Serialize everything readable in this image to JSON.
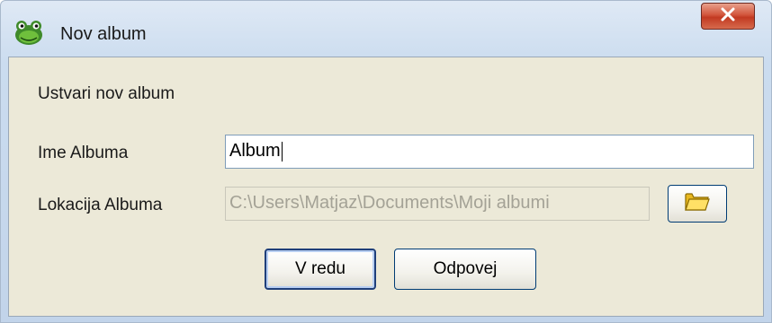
{
  "window": {
    "title": "Nov album",
    "close_label": "X"
  },
  "dialog": {
    "intro": "Ustvari nov album",
    "name_label": "Ime Albuma",
    "name_value": "Album",
    "location_label": "Lokacija Albuma",
    "location_value": "C:\\Users\\Matjaz\\Documents\\Moji albumi",
    "ok_label": "V redu",
    "cancel_label": "Odpovej"
  },
  "icons": {
    "app": "frog-app-icon",
    "folder": "folder-icon",
    "close": "close-icon"
  },
  "colors": {
    "dialog_background": "#ece9d8",
    "close_button": "#c23a22",
    "input_border": "#7f9db9"
  }
}
